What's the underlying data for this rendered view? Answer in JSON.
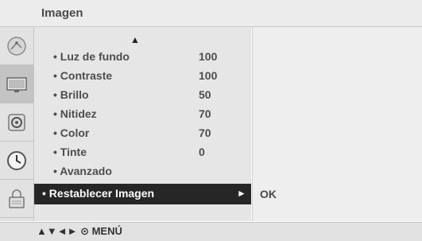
{
  "window": {
    "title": "Imagen"
  },
  "categories": [
    {
      "icon": "satellite-dish-icon"
    },
    {
      "icon": "tv-screen-icon",
      "active": true
    },
    {
      "icon": "speaker-icon"
    },
    {
      "icon": "clock-icon"
    },
    {
      "icon": "lock-icon"
    }
  ],
  "menu": {
    "scroll_up": "▲",
    "items": [
      {
        "label": "• Luz de fundo",
        "value": "100"
      },
      {
        "label": "• Contraste",
        "value": "100"
      },
      {
        "label": "• Brillo",
        "value": "50"
      },
      {
        "label": "• Nitidez",
        "value": "70"
      },
      {
        "label": "• Color",
        "value": "70"
      },
      {
        "label": "• Tinte",
        "value": "0"
      },
      {
        "label": "• Avanzado",
        "value": ""
      }
    ],
    "selected": {
      "label": "• Restablecer Imagen",
      "arrow": "►"
    }
  },
  "submenu": {
    "ok": "OK"
  },
  "footer": {
    "hint": "▲▼◄► ⊙ MENÚ"
  },
  "colors": {
    "selected_bg": "#262626",
    "panel_bg": "#e6e6e6"
  }
}
